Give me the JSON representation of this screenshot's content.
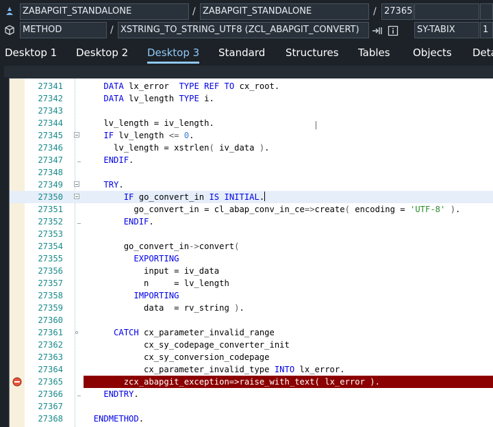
{
  "header": {
    "row1": {
      "program": "ZABAPGIT_STANDALONE",
      "include": "ZABAPGIT_STANDALONE",
      "line": "27365",
      "extra": ""
    },
    "row2": {
      "object_type": "METHOD",
      "object_name": "XSTRING_TO_STRING_UTF8 (ZCL_ABAPGIT_CONVERT)",
      "variable": "SY-TABIX",
      "variable_value": "1"
    },
    "slash": "/"
  },
  "tabs": [
    "Desktop 1",
    "Desktop 2",
    "Desktop 3",
    "Standard",
    "Structures",
    "Tables",
    "Objects",
    "Deta"
  ],
  "active_tab": "Desktop 3",
  "editor": {
    "lines": [
      {
        "num": "27341",
        "text": "    DATA lx_error  TYPE REF TO cx_root."
      },
      {
        "num": "27342",
        "text": "    DATA lv_length TYPE i."
      },
      {
        "num": "27343",
        "text": ""
      },
      {
        "num": "27344",
        "text": "    lv_length = iv_length."
      },
      {
        "num": "27345",
        "text": "    IF lv_length <= 0."
      },
      {
        "num": "27346",
        "text": "      lv_length = xstrlen( iv_data )."
      },
      {
        "num": "27347",
        "text": "    ENDIF."
      },
      {
        "num": "27348",
        "text": ""
      },
      {
        "num": "27349",
        "text": "    TRY."
      },
      {
        "num": "27350",
        "text": "        IF go_convert_in IS INITIAL."
      },
      {
        "num": "27351",
        "text": "          go_convert_in = cl_abap_conv_in_ce=>create( encoding = 'UTF-8' )."
      },
      {
        "num": "27352",
        "text": "        ENDIF."
      },
      {
        "num": "27353",
        "text": ""
      },
      {
        "num": "27354",
        "text": "        go_convert_in->convert("
      },
      {
        "num": "27355",
        "text": "          EXPORTING"
      },
      {
        "num": "27356",
        "text": "            input = iv_data"
      },
      {
        "num": "27357",
        "text": "            n     = lv_length"
      },
      {
        "num": "27358",
        "text": "          IMPORTING"
      },
      {
        "num": "27359",
        "text": "            data  = rv_string )."
      },
      {
        "num": "27360",
        "text": ""
      },
      {
        "num": "27361",
        "text": "      CATCH cx_parameter_invalid_range"
      },
      {
        "num": "27362",
        "text": "            cx_sy_codepage_converter_init"
      },
      {
        "num": "27363",
        "text": "            cx_sy_conversion_codepage"
      },
      {
        "num": "27364",
        "text": "            cx_parameter_invalid_type INTO lx_error."
      },
      {
        "num": "27365",
        "text": "        zcx_abapgit_exception=>raise_with_text( lx_error )."
      },
      {
        "num": "27366",
        "text": "    ENDTRY."
      },
      {
        "num": "27367",
        "text": ""
      },
      {
        "num": "27368",
        "text": "  ENDMETHOD."
      }
    ],
    "current_line": "27350",
    "breakpoint_line": "27365"
  },
  "colors": {
    "background": "#1c2228",
    "accent": "#91c8f6",
    "keyword": "#0000e6",
    "string": "#2e8b2e",
    "line_number": "#1a8a8a",
    "error_line": "#8b0000",
    "current_line": "#e5eef9"
  }
}
